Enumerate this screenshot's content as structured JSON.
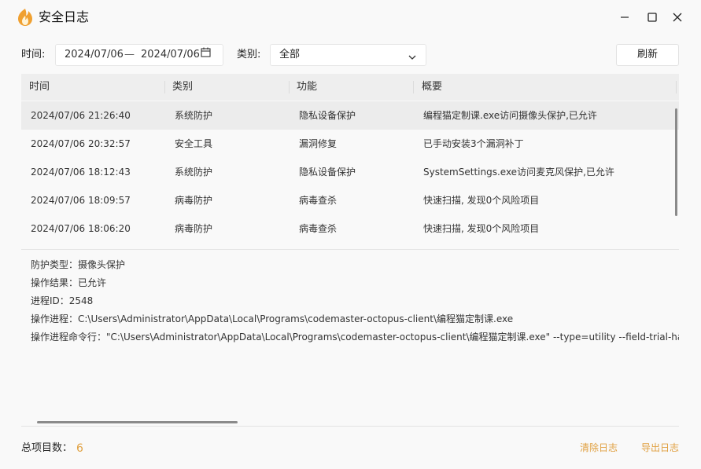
{
  "window": {
    "title": "安全日志",
    "logo_icon": "flame-shield-icon",
    "accent_color": "#f0a030"
  },
  "filters": {
    "time_label": "时间:",
    "date_from": "2024/07/06",
    "date_sep": "—",
    "date_to": "2024/07/06",
    "category_label": "类别:",
    "category_value": "全部",
    "refresh_label": "刷新"
  },
  "table": {
    "columns": [
      "时间",
      "类别",
      "功能",
      "概要"
    ],
    "rows": [
      {
        "time": "2024/07/06 21:26:40",
        "category": "系统防护",
        "feature": "隐私设备保护",
        "summary": "编程猫定制课.exe访问摄像头保护,已允许",
        "selected": true
      },
      {
        "time": "2024/07/06 20:32:57",
        "category": "安全工具",
        "feature": "漏洞修复",
        "summary": "已手动安装3个漏洞补丁",
        "selected": false
      },
      {
        "time": "2024/07/06 18:12:43",
        "category": "系统防护",
        "feature": "隐私设备保护",
        "summary": "SystemSettings.exe访问麦克风保护,已允许",
        "selected": false
      },
      {
        "time": "2024/07/06 18:09:57",
        "category": "病毒防护",
        "feature": "病毒查杀",
        "summary": "快速扫描, 发现0个风险项目",
        "selected": false
      },
      {
        "time": "2024/07/06 18:06:20",
        "category": "病毒防护",
        "feature": "病毒查杀",
        "summary": "快速扫描, 发现0个风险项目",
        "selected": false
      }
    ]
  },
  "detail": [
    "防护类型：摄像头保护",
    "操作结果：已允许",
    "进程ID：2548",
    "操作进程：C:\\Users\\Administrator\\AppData\\Local\\Programs\\codemaster-octopus-client\\编程猫定制课.exe",
    "操作进程命令行：\"C:\\Users\\Administrator\\AppData\\Local\\Programs\\codemaster-octopus-client\\编程猫定制课.exe\" --type=utility --field-trial-handle"
  ],
  "footer": {
    "total_label": "总项目数：",
    "total_count": "6",
    "clear_label": "清除日志",
    "export_label": "导出日志"
  }
}
